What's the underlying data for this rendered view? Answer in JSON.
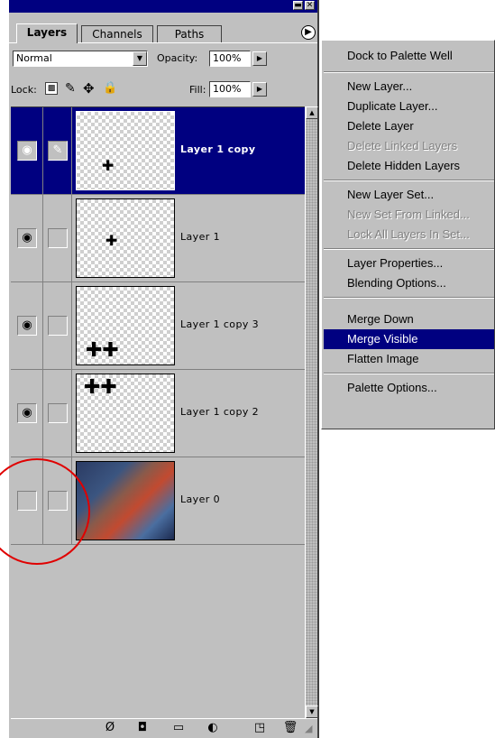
{
  "tabs": [
    {
      "label": "Layers",
      "active": true
    },
    {
      "label": "Channels",
      "active": false
    },
    {
      "label": "Paths",
      "active": false
    }
  ],
  "blend": {
    "mode": "Normal",
    "opacity_label": "Opacity:",
    "opacity": "100%"
  },
  "lock": {
    "label": "Lock:",
    "fill_label": "Fill:",
    "fill": "100%"
  },
  "layers": [
    {
      "name": "Layer 1 copy",
      "selected": true,
      "visible": true,
      "brush": true
    },
    {
      "name": "Layer 1",
      "selected": false,
      "visible": true,
      "brush": false
    },
    {
      "name": "Layer 1 copy 3",
      "selected": false,
      "visible": true,
      "brush": false
    },
    {
      "name": "Layer 1 copy 2",
      "selected": false,
      "visible": true,
      "brush": false
    },
    {
      "name": "Layer 0",
      "selected": false,
      "visible": false,
      "brush": false
    }
  ],
  "menu": {
    "items": [
      {
        "label": "Dock to Palette Well",
        "disabled": false
      },
      {
        "label": "New Layer...",
        "disabled": false
      },
      {
        "label": "Duplicate Layer...",
        "disabled": false
      },
      {
        "label": "Delete Layer",
        "disabled": false
      },
      {
        "label": "Delete Linked Layers",
        "disabled": true
      },
      {
        "label": "Delete Hidden Layers",
        "disabled": false
      },
      {
        "label": "New Layer Set...",
        "disabled": false
      },
      {
        "label": "New Set From Linked...",
        "disabled": true
      },
      {
        "label": "Lock All Layers In Set...",
        "disabled": true
      },
      {
        "label": "Layer Properties...",
        "disabled": false
      },
      {
        "label": "Blending Options...",
        "disabled": false
      },
      {
        "label": "Merge Down",
        "disabled": false
      },
      {
        "label": "Merge Visible",
        "disabled": false,
        "highlighted": true
      },
      {
        "label": "Flatten Image",
        "disabled": false
      },
      {
        "label": "Palette Options...",
        "disabled": false
      }
    ]
  },
  "icons": {
    "eye": "eye-icon",
    "brush": "brush-icon",
    "menu_arrow": "palette-menu-icon",
    "lock_transparency": "lock-transparency-icon",
    "lock_image": "lock-brush-icon",
    "lock_position": "lock-move-icon",
    "lock_all": "lock-all-icon"
  },
  "colors": {
    "selection": "#000080",
    "panel": "#c0c0c0",
    "annotation_circle": "#e00000"
  }
}
